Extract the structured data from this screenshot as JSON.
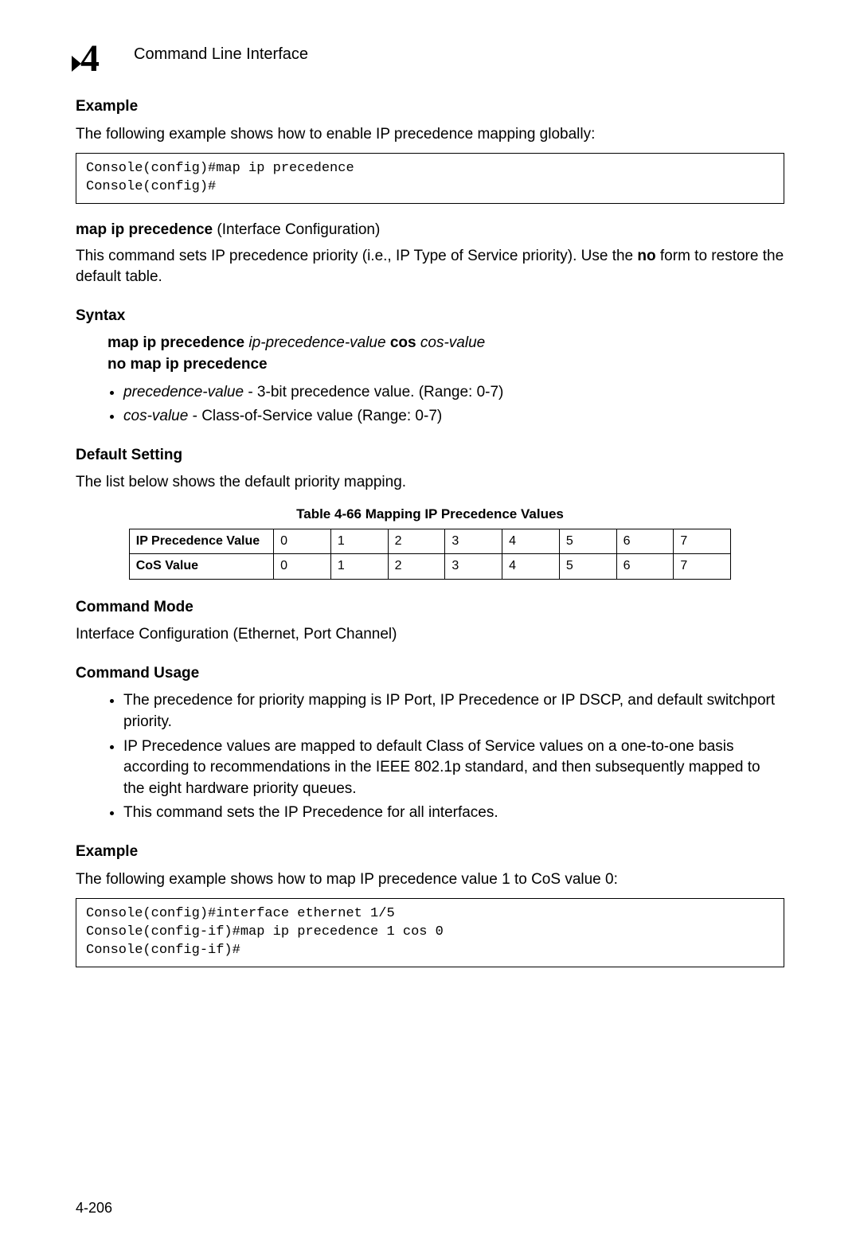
{
  "header": {
    "chapter_number": "4",
    "chapter_title": "Command Line Interface"
  },
  "sections": {
    "example1": {
      "heading": "Example",
      "intro": "The following example shows how to enable IP precedence mapping globally:",
      "code": "Console(config)#map ip precedence\nConsole(config)#"
    },
    "cmdhead": {
      "bold": "map ip precedence",
      "rest": " (Interface Configuration)"
    },
    "cmddesc_a": "This command sets IP precedence priority (i.e., IP Type of Service priority). Use the ",
    "cmddesc_b": "no",
    "cmddesc_c": " form to restore the default table.",
    "syntax": {
      "heading": "Syntax",
      "line1_b1": "map ip precedence ",
      "line1_i1": "ip-precedence-value",
      "line1_b2": " cos ",
      "line1_i2": "cos-value",
      "line2": "no map ip precedence",
      "bullets": [
        {
          "i": "precedence-value",
          "t": " - 3-bit precedence value. (Range: 0-7)"
        },
        {
          "i": "cos-value",
          "t": " - Class-of-Service value (Range: 0-7)"
        }
      ]
    },
    "default": {
      "heading": "Default Setting",
      "text": "The list below shows the default priority mapping."
    },
    "cmdmode": {
      "heading": "Command Mode",
      "text": "Interface Configuration (Ethernet, Port Channel)"
    },
    "cmdusage": {
      "heading": "Command Usage",
      "bullets": [
        "The precedence for priority mapping is IP Port, IP Precedence or IP DSCP, and default switchport priority.",
        "IP Precedence values are mapped to default Class of Service values on a one-to-one basis according to recommendations in the IEEE 802.1p standard, and then subsequently mapped to the eight hardware priority queues.",
        "This command sets the IP Precedence for all interfaces."
      ]
    },
    "example2": {
      "heading": "Example",
      "intro": "The following example shows how to map IP precedence value 1 to CoS value 0:",
      "code": "Console(config)#interface ethernet 1/5\nConsole(config-if)#map ip precedence 1 cos 0\nConsole(config-if)#"
    }
  },
  "chart_data": {
    "type": "table",
    "title": "Table 4-66  Mapping IP Precedence Values",
    "rows": [
      {
        "label": "IP Precedence Value",
        "values": [
          "0",
          "1",
          "2",
          "3",
          "4",
          "5",
          "6",
          "7"
        ]
      },
      {
        "label": "CoS Value",
        "values": [
          "0",
          "1",
          "2",
          "3",
          "4",
          "5",
          "6",
          "7"
        ]
      }
    ]
  },
  "page_number": "4-206"
}
